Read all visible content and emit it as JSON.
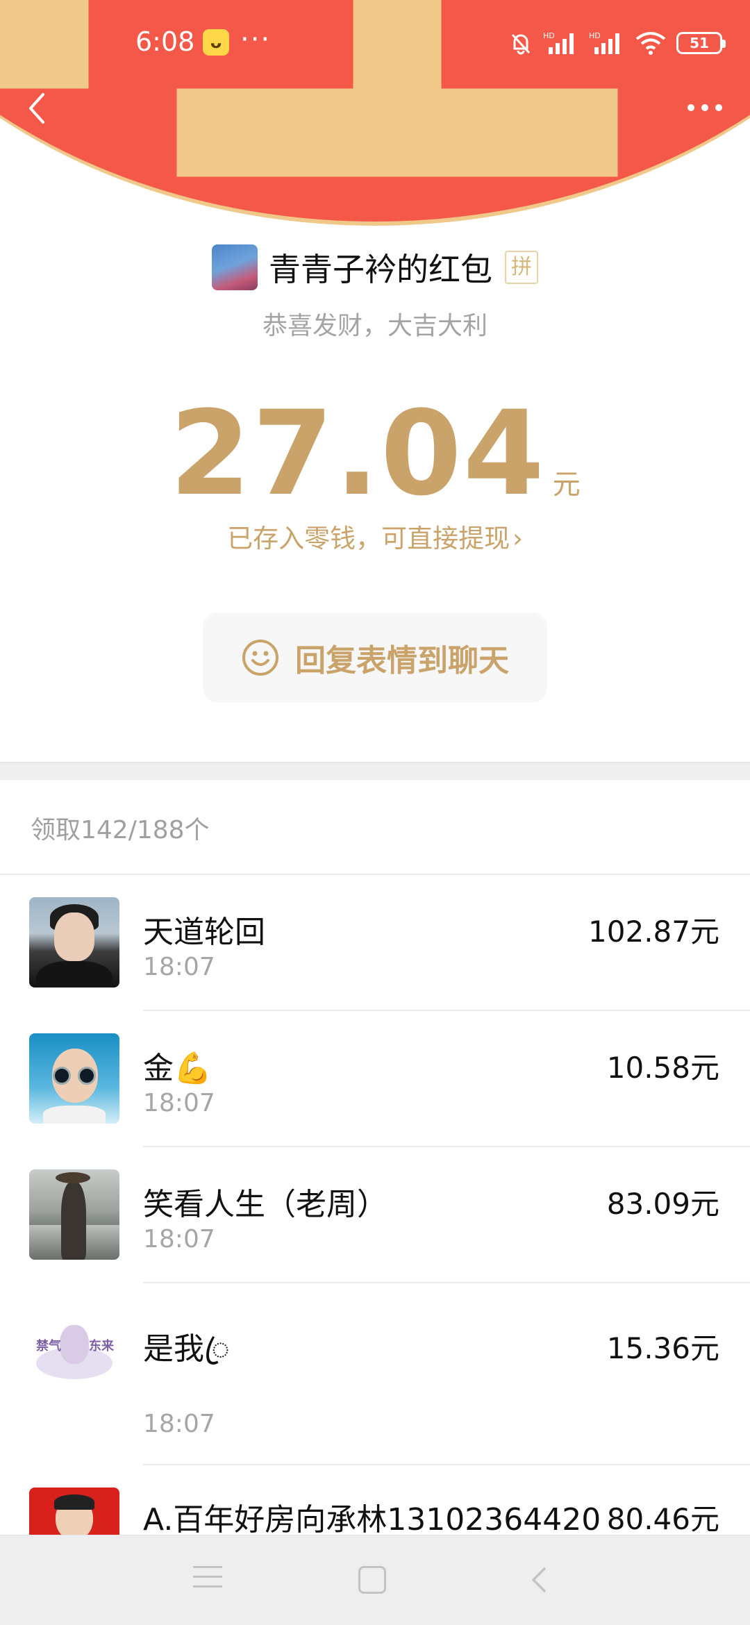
{
  "status_bar": {
    "time": "6:08",
    "dots": "···",
    "battery": "51",
    "signal_label_1": "HD",
    "signal_label_2": "HD"
  },
  "header": {
    "sender_name": "青青子衿的红包",
    "pin_tag": "拼",
    "blessing": "恭喜发财，大吉大利"
  },
  "amount": {
    "value": "27.04",
    "unit": "元",
    "stored_tip": "已存入零钱，可直接提现",
    "stored_chevron": "›"
  },
  "reply_button": {
    "label": "回复表情到聊天"
  },
  "received": {
    "summary": "领取142/188个",
    "items": [
      {
        "name": "天道轮回",
        "time": "18:07",
        "amount": "102.87元"
      },
      {
        "name": "金💪",
        "time": "18:07",
        "amount": "10.58元"
      },
      {
        "name": "笑看人生（老周）",
        "time": "18:07",
        "amount": "83.09元"
      },
      {
        "name": "是我ꦿ",
        "time": "18:07",
        "amount": "15.36元"
      },
      {
        "name": "A.百年好房向承林13102364420",
        "time": "",
        "amount": "80.46元"
      }
    ]
  },
  "avatar_text": {
    "left": "禁气",
    "right": "东来"
  },
  "colors": {
    "header_red": "#f45848",
    "gold": "#c9a36a"
  }
}
